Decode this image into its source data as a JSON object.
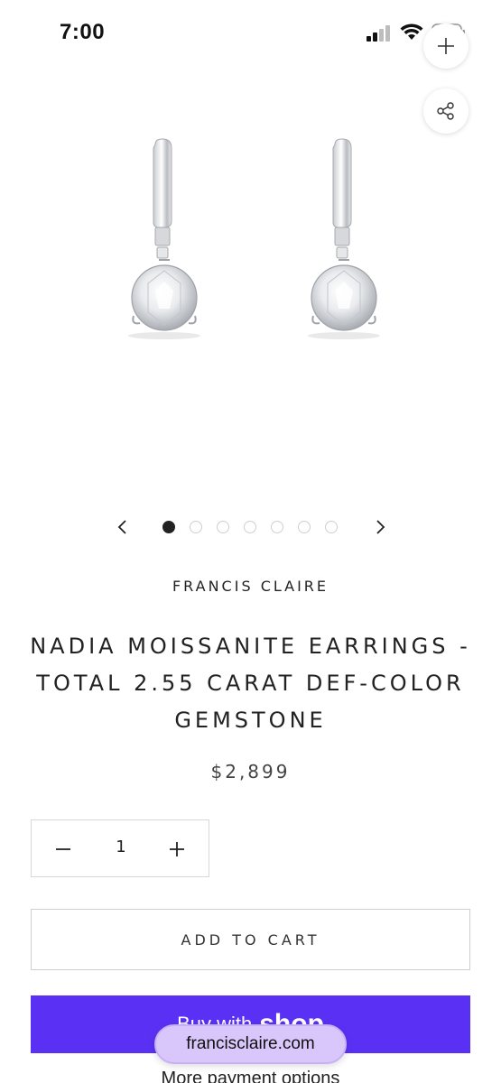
{
  "status_bar": {
    "time": "7:00",
    "icons": [
      "cellular-signal-icon",
      "wifi-icon",
      "battery-icon"
    ]
  },
  "toolbar": {
    "plus_icon": "plus-icon",
    "share_icon": "share-icon"
  },
  "product": {
    "image_alt": "earrings-product-image",
    "brand": "FRANCIS CLAIRE",
    "title": "NADIA MOISSANITE EARRINGS - TOTAL 2.55 CARAT DEF-COLOR GEMSTONE",
    "price": "$2,899"
  },
  "carousel": {
    "prev_icon": "chevron-left-icon",
    "next_icon": "chevron-right-icon",
    "dots_total": 7,
    "active_index": 0
  },
  "quantity": {
    "value": "1",
    "minus_icon": "minus-icon",
    "plus_icon": "plus-icon"
  },
  "actions": {
    "add_to_cart": "ADD TO CART",
    "buy_with": "Buy with",
    "shop_logo": "shop",
    "more_payment": "More payment options"
  },
  "browser": {
    "url": "francisclaire.com"
  },
  "colors": {
    "shop_pay_bg": "#5a31f4",
    "url_pill_bg": "#d9c6fb",
    "text": "#222222"
  }
}
